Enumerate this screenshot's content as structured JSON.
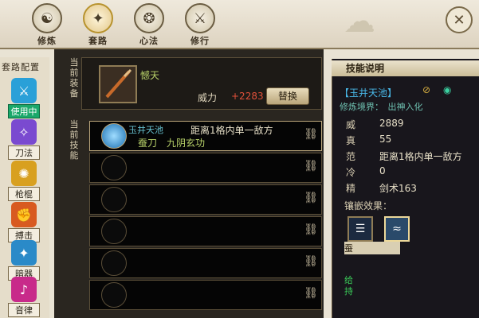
{
  "top_tabs": [
    {
      "label": "修炼",
      "icon": "cultivate-icon"
    },
    {
      "label": "套路",
      "icon": "routine-icon"
    },
    {
      "label": "心法",
      "icon": "mind-method-icon"
    },
    {
      "label": "修行",
      "icon": "practice-icon"
    }
  ],
  "sidebar": {
    "title": "套路配置",
    "items": [
      {
        "label": "使用中",
        "color": "#2aa0d8",
        "icon": "swords-icon"
      },
      {
        "label": "刀法",
        "color": "#7a4ad0",
        "icon": "blade-icon"
      },
      {
        "label": "枪棍",
        "color": "#d8a020",
        "icon": "spear-icon"
      },
      {
        "label": "搏击",
        "color": "#d85a20",
        "icon": "fist-icon"
      },
      {
        "label": "暗器",
        "color": "#2a8ac8",
        "icon": "dart-icon"
      },
      {
        "label": "音律",
        "color": "#c82a8a",
        "icon": "music-icon"
      }
    ]
  },
  "equip": {
    "label_current": "当前",
    "label_equip": "装备",
    "weapon_name": "憾天",
    "power_label": "威力",
    "power_value": "+2283",
    "replace_label": "替换"
  },
  "skills": {
    "label_current": "当前",
    "label_skill": "技能",
    "slots": [
      {
        "name": "玉井天池",
        "desc": "距离1格内单一敌方",
        "line": "蚕刀　九阴玄功",
        "active": true
      },
      {
        "name": "",
        "desc": "",
        "line": "",
        "active": false
      },
      {
        "name": "",
        "desc": "",
        "line": "",
        "active": false
      },
      {
        "name": "",
        "desc": "",
        "line": "",
        "active": false
      },
      {
        "name": "",
        "desc": "",
        "line": "",
        "active": false
      },
      {
        "name": "",
        "desc": "",
        "line": "",
        "active": false
      }
    ]
  },
  "skill_detail": {
    "title": "技能说明",
    "name": "【玉井天池】",
    "level": "修炼境界：　出神入化",
    "stats": [
      {
        "k": "威",
        "v": "2889"
      },
      {
        "k": "真",
        "v": "55"
      },
      {
        "k": "范",
        "v": "距离1格内单一敌方"
      },
      {
        "k": "冷",
        "v": "0"
      },
      {
        "k": "精",
        "v": "剑术163"
      }
    ],
    "inlay_label": "镶嵌效果：",
    "foot_label": "蚕",
    "foot_text": "给\n持"
  }
}
